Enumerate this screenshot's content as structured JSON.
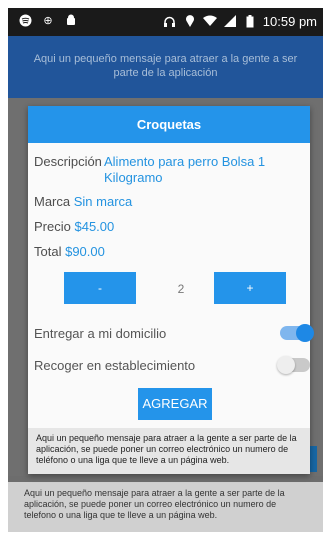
{
  "status_bar": {
    "time": "10:59 pm",
    "left_icons": [
      "spotify-icon",
      "usb-icon",
      "android-debug-icon"
    ],
    "right_icons": [
      "headphones-icon",
      "location-icon",
      "wifi-icon",
      "signal-icon",
      "battery-icon"
    ]
  },
  "background": {
    "header_message": "Aqui un pequeño mensaje para atraer a la gente a ser parte de la aplicación",
    "footer_message": "Aqui un pequeño mensaje para atraer a la gente a ser parte de la aplicación, se puede poner un correo electrónico un numero de telefono o una liga que te lleve a un página web."
  },
  "dialog": {
    "title": "Croquetas",
    "description_label": "Descripción",
    "description_value": "Alimento para perro Bolsa 1 Kilogramo",
    "brand_label": "Marca",
    "brand_value": "Sin marca",
    "price_label": "Precio",
    "price_value": "$45.00",
    "total_label": "Total",
    "total_value": "$90.00",
    "minus_label": "-",
    "plus_label": "+",
    "quantity": "2",
    "deliver_label": "Entregar a mi domicilio",
    "deliver_on": true,
    "pickup_label": "Recoger en establecimiento",
    "pickup_on": false,
    "add_label": "AGREGAR",
    "footer_message": "Aqui un pequeño mensaje para atraer a la gente a ser parte de la aplicación, se puede poner un correo electrónico un numero de teléfono o una liga que te lleve a un página web."
  },
  "colors": {
    "accent": "#2494ea",
    "header_bg": "#21559a",
    "toggle_on": "#1e88e5"
  }
}
